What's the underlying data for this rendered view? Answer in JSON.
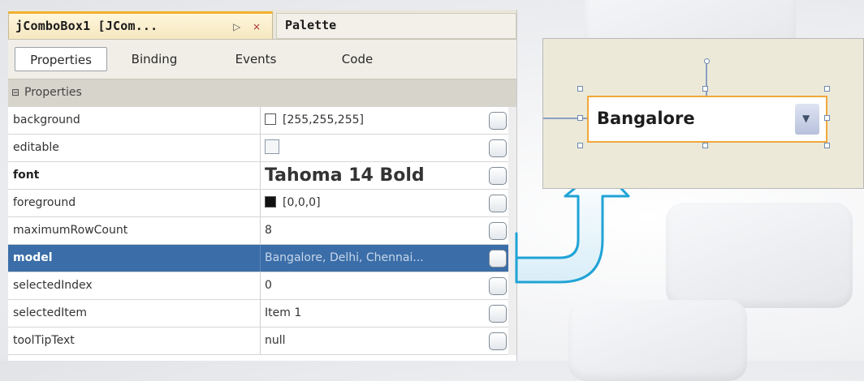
{
  "tabs": {
    "active_title": "jComboBox1 [JCom...",
    "other_title": "Palette"
  },
  "subtabs": [
    "Properties",
    "Binding",
    "Events",
    "Code"
  ],
  "section_header": "Properties",
  "properties": [
    {
      "name": "background",
      "value": "[255,255,255]",
      "swatch": "#ffffff"
    },
    {
      "name": "editable",
      "value": ""
    },
    {
      "name": "font",
      "value": "Tahoma 14 Bold"
    },
    {
      "name": "foreground",
      "value": "[0,0,0]",
      "swatch": "#111111"
    },
    {
      "name": "maximumRowCount",
      "value": "8"
    },
    {
      "name": "model",
      "value": "Bangalore, Delhi, Chennai..."
    },
    {
      "name": "selectedIndex",
      "value": "0"
    },
    {
      "name": "selectedItem",
      "value": "Item 1"
    },
    {
      "name": "toolTipText",
      "value": "null"
    }
  ],
  "preview": {
    "combo_value": "Bangalore"
  },
  "colors": {
    "selection": "#3b6ea8",
    "arrow": "#1fa3d6",
    "combo_border": "#f0a83a"
  }
}
